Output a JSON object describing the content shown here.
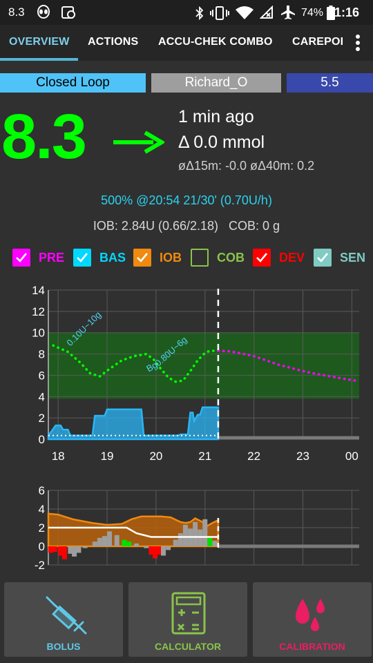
{
  "status_bar": {
    "bg_badge": "8.3",
    "battery": "74%",
    "time": "21:16",
    "icons": [
      "alien-icon",
      "image-icon",
      "map-icon",
      "bluetooth-icon",
      "vibrate-icon",
      "wifi-icon",
      "no-signal-icon",
      "airplane-icon",
      "battery-icon"
    ]
  },
  "tabs": [
    {
      "label": "OVERVIEW",
      "active": true
    },
    {
      "label": "ACTIONS",
      "active": false
    },
    {
      "label": "ACCU-CHEK COMBO",
      "active": false
    },
    {
      "label": "CAREPOI",
      "active": false
    }
  ],
  "menu_icon": "more-vert-icon",
  "header_pills": {
    "loop_mode": "Closed Loop",
    "profile": "Richard_O",
    "target": "5.5"
  },
  "bg": {
    "value": "8.3",
    "trend_icon": "arrow-right-icon",
    "color": "#00ff00",
    "time_ago": "1 min ago",
    "delta": "Δ 0.0 mmol",
    "avg_delta": "øΔ15m: -0.0  øΔ40m: 0.2"
  },
  "temp_basal": "500% @20:54 21/30' (0.70U/h)",
  "iob_cob": "IOB: 2.84U (0.66/2.18)   COB: 0 g",
  "graph_toggles": [
    {
      "label": "PRE",
      "checked": true,
      "color": "#ff00ff"
    },
    {
      "label": "BAS",
      "checked": true,
      "color": "#00d8ff"
    },
    {
      "label": "IOB",
      "checked": true,
      "color": "#f08a10"
    },
    {
      "label": "COB",
      "checked": false,
      "color": "#8bc34a"
    },
    {
      "label": "DEV",
      "checked": true,
      "color": "#ff0000"
    },
    {
      "label": "SEN",
      "checked": true,
      "color": "#80cbc4"
    }
  ],
  "chart_data": [
    {
      "type": "line",
      "ylim": [
        0,
        14
      ],
      "yticks": [
        0,
        2,
        4,
        6,
        8,
        10,
        12,
        14
      ],
      "xticks": [
        "18",
        "19",
        "20",
        "21",
        "22",
        "23",
        "00"
      ],
      "xlim": [
        17.8,
        24.15
      ],
      "now": 21.27,
      "target_range": [
        3.8,
        10.0
      ],
      "bg_series": {
        "name": "",
        "color": "#00ff00",
        "x": [
          17.9,
          18.2,
          18.45,
          18.65,
          18.85,
          19.05,
          19.3,
          19.55,
          19.8,
          19.95,
          20.1,
          20.25,
          20.4,
          20.55,
          20.7,
          20.85,
          21.0,
          21.1,
          21.27
        ],
        "y": [
          8.8,
          8.2,
          7.2,
          6.2,
          5.9,
          6.6,
          7.4,
          7.8,
          8.0,
          7.5,
          6.6,
          5.8,
          5.4,
          5.5,
          6.4,
          7.4,
          8.1,
          8.3,
          8.3
        ]
      },
      "prediction_series": {
        "name": "",
        "color": "#ff00ff",
        "x": [
          21.27,
          21.5,
          21.75,
          22.0,
          22.25,
          22.5,
          22.75,
          23.0,
          23.25,
          23.5,
          23.75,
          24.0,
          24.15
        ],
        "y": [
          8.3,
          8.25,
          8.05,
          7.8,
          7.4,
          7.0,
          6.7,
          6.4,
          6.15,
          5.95,
          5.75,
          5.55,
          5.45
        ]
      },
      "basal_series": {
        "name": "",
        "color": "#29b6f6",
        "x": [
          17.8,
          17.95,
          18.05,
          18.1,
          18.2,
          18.25,
          18.7,
          18.75,
          18.95,
          19.0,
          19.7,
          19.75,
          20.45,
          20.5,
          20.65,
          20.7,
          20.75,
          20.78,
          20.85,
          20.9,
          20.95,
          21.27
        ],
        "y": [
          0.35,
          1.3,
          1.3,
          0.9,
          0.9,
          0.35,
          0.35,
          2.2,
          2.2,
          2.8,
          2.8,
          0.35,
          0.35,
          0.45,
          0.45,
          2.5,
          2.5,
          1.7,
          2.3,
          2.3,
          3.0,
          3.0
        ]
      },
      "treatment_labels": [
        "0.10U~10g",
        "Bg",
        "0.80U~6g"
      ]
    },
    {
      "type": "area",
      "ylim": [
        -2,
        6
      ],
      "yticks": [
        6,
        4,
        2,
        0,
        -2
      ],
      "xlim": [
        17.8,
        24.15
      ],
      "now": 21.27,
      "iob_series": {
        "name": "",
        "color": "#f08a10",
        "x": [
          17.8,
          18.0,
          18.3,
          18.7,
          19.0,
          19.3,
          19.5,
          19.7,
          19.9,
          20.1,
          20.3,
          20.5,
          20.6,
          20.7,
          20.8,
          20.95,
          21.05,
          21.15,
          21.27
        ],
        "y": [
          3.5,
          3.4,
          2.9,
          2.5,
          2.3,
          2.4,
          2.9,
          3.2,
          3.2,
          3.2,
          3.1,
          2.6,
          2.5,
          2.6,
          3.0,
          2.6,
          2.2,
          2.5,
          2.8
        ]
      },
      "sensitivity_series": {
        "name": "",
        "color": "#ffffff",
        "x": [
          17.8,
          18.5,
          19.0,
          19.4,
          19.6,
          19.9,
          20.4,
          20.8,
          21.27
        ],
        "y": [
          2.0,
          2.0,
          2.0,
          2.0,
          1.4,
          1.0,
          1.0,
          1.0,
          1.0
        ]
      },
      "deviations": [
        {
          "x": 17.85,
          "v": -0.7,
          "c": "#ff0000"
        },
        {
          "x": 17.93,
          "v": -0.6,
          "c": "#ff0000"
        },
        {
          "x": 18.05,
          "v": -1.0,
          "c": "#ff0000"
        },
        {
          "x": 18.13,
          "v": -1.4,
          "c": "#ff0000"
        },
        {
          "x": 18.25,
          "v": -0.8,
          "c": "#9e9e9e"
        },
        {
          "x": 18.33,
          "v": -1.1,
          "c": "#9e9e9e"
        },
        {
          "x": 18.42,
          "v": -0.7,
          "c": "#9e9e9e"
        },
        {
          "x": 18.55,
          "v": -0.2,
          "c": "#9e9e9e"
        },
        {
          "x": 18.75,
          "v": 0.5,
          "c": "#9e9e9e"
        },
        {
          "x": 18.85,
          "v": 0.9,
          "c": "#9e9e9e"
        },
        {
          "x": 18.95,
          "v": 1.1,
          "c": "#9e9e9e"
        },
        {
          "x": 19.05,
          "v": 1.6,
          "c": "#9e9e9e"
        },
        {
          "x": 19.2,
          "v": 1.2,
          "c": "#9e9e9e"
        },
        {
          "x": 19.35,
          "v": 0.7,
          "c": "#00e000"
        },
        {
          "x": 19.45,
          "v": 0.5,
          "c": "#00e000"
        },
        {
          "x": 19.6,
          "v": 0.3,
          "c": "#9e9e9e"
        },
        {
          "x": 19.8,
          "v": -0.2,
          "c": "#9e9e9e"
        },
        {
          "x": 19.9,
          "v": -0.9,
          "c": "#ff0000"
        },
        {
          "x": 19.98,
          "v": -1.3,
          "c": "#ff0000"
        },
        {
          "x": 20.06,
          "v": -0.9,
          "c": "#ff0000"
        },
        {
          "x": 20.15,
          "v": -1.0,
          "c": "#9e9e9e"
        },
        {
          "x": 20.25,
          "v": -0.4,
          "c": "#9e9e9e"
        },
        {
          "x": 20.4,
          "v": 0.7,
          "c": "#9e9e9e"
        },
        {
          "x": 20.5,
          "v": 1.4,
          "c": "#9e9e9e"
        },
        {
          "x": 20.6,
          "v": 2.3,
          "c": "#9e9e9e"
        },
        {
          "x": 20.7,
          "v": 1.9,
          "c": "#9e9e9e"
        },
        {
          "x": 20.8,
          "v": 2.6,
          "c": "#9e9e9e"
        },
        {
          "x": 20.9,
          "v": 1.8,
          "c": "#9e9e9e"
        },
        {
          "x": 21.0,
          "v": 2.9,
          "c": "#9e9e9e"
        },
        {
          "x": 21.1,
          "v": 0.9,
          "c": "#00e000"
        },
        {
          "x": 21.2,
          "v": 0.6,
          "c": "#9e9e9e"
        }
      ]
    }
  ],
  "buttons": [
    {
      "label": "BOLUS",
      "icon": "syringe-icon",
      "color": "#5fc8e6"
    },
    {
      "label": "CALCULATOR",
      "icon": "calculator-icon",
      "color": "#8bc34a"
    },
    {
      "label": "CALIBRATION",
      "icon": "blood-drops-icon",
      "color": "#e91e63"
    }
  ]
}
